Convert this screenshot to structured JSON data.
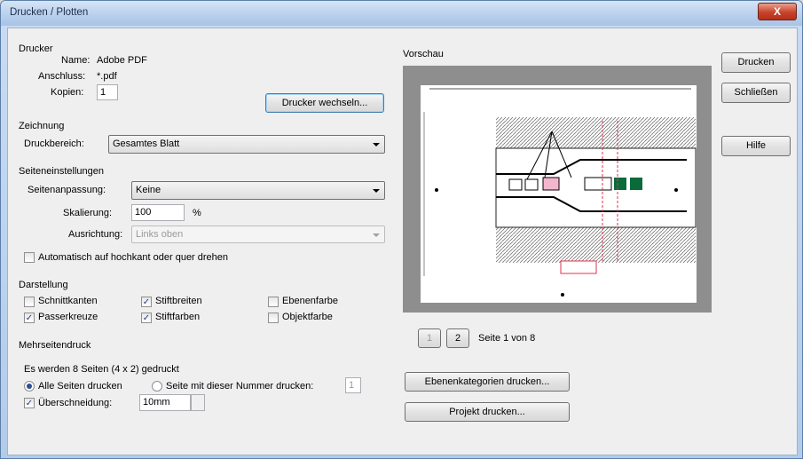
{
  "window": {
    "title": "Drucken / Plotten",
    "close_label": "X"
  },
  "printer": {
    "group_label": "Drucker",
    "name_label": "Name:",
    "name_value": "Adobe PDF",
    "port_label": "Anschluss:",
    "port_value": "*.pdf",
    "copies_label": "Kopien:",
    "copies_value": "1",
    "change_button": "Drucker wechseln..."
  },
  "drawing": {
    "group_label": "Zeichnung",
    "range_label": "Druckbereich:",
    "range_value": "Gesamtes Blatt"
  },
  "page_settings": {
    "group_label": "Seiteneinstellungen",
    "fit_label": "Seitenanpassung:",
    "fit_value": "Keine",
    "scale_label": "Skalierung:",
    "scale_value": "100",
    "scale_unit": "%",
    "align_label": "Ausrichtung:",
    "align_value": "Links oben",
    "auto_rotate_label": "Automatisch auf hochkant oder quer drehen",
    "auto_rotate_checked": false
  },
  "display": {
    "group_label": "Darstellung",
    "options": [
      {
        "label": "Schnittkanten",
        "checked": false
      },
      {
        "label": "Passerkreuze",
        "checked": true
      },
      {
        "label": "Stiftbreiten",
        "checked": true
      },
      {
        "label": "Stiftfarben",
        "checked": true
      },
      {
        "label": "Ebenenfarbe",
        "checked": false
      },
      {
        "label": "Objektfarbe",
        "checked": false
      }
    ]
  },
  "multipage": {
    "group_label": "Mehrseitendruck",
    "info": "Es werden 8 Seiten (4 x 2) gedruckt",
    "all_pages_label": "Alle Seiten drucken",
    "page_number_label": "Seite mit dieser Nummer drucken:",
    "page_number_value": "1",
    "overlap_label": "Überschneidung:",
    "overlap_value": "10mm",
    "overlap_checked": true
  },
  "preview": {
    "group_label": "Vorschau",
    "pager_prev": "1",
    "pager_next": "2",
    "page_status": "Seite 1 von 8"
  },
  "buttons": {
    "print": "Drucken",
    "close": "Schließen",
    "help": "Hilfe",
    "print_layer_categories": "Ebenenkategorien drucken...",
    "print_project": "Projekt drucken..."
  }
}
